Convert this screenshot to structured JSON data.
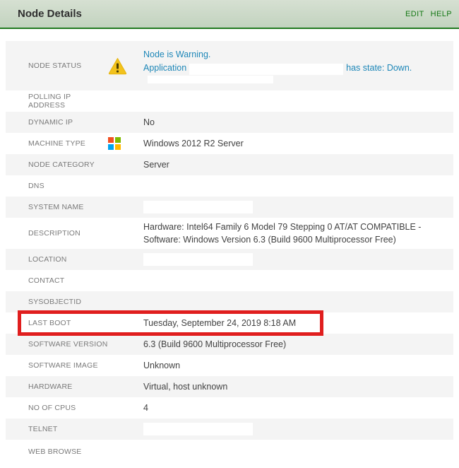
{
  "header": {
    "title": "Node Details",
    "links": [
      {
        "label": "EDIT"
      },
      {
        "label": "HELP"
      }
    ]
  },
  "status_row": {
    "line1": "Node is Warning.",
    "line2_prefix": "Application",
    "line2_suffix": "has state: Down."
  },
  "rows": [
    {
      "label": "NODE STATUS",
      "value": "",
      "bg": "gray",
      "icon": "warning",
      "status": true,
      "height": "h70"
    },
    {
      "label": "POLLING IP ADDRESS",
      "value": "",
      "bg": "white"
    },
    {
      "label": "DYNAMIC IP",
      "value": "No",
      "bg": "gray"
    },
    {
      "label": "MACHINE TYPE",
      "value": "Windows 2012 R2 Server",
      "bg": "white",
      "icon": "windows"
    },
    {
      "label": "NODE CATEGORY",
      "value": "Server",
      "bg": "gray"
    },
    {
      "label": "DNS",
      "value": "",
      "bg": "white"
    },
    {
      "label": "SYSTEM NAME",
      "value": "",
      "bg": "gray",
      "redacted": true
    },
    {
      "label": "DESCRIPTION",
      "value": "Hardware: Intel64 Family 6 Model 79 Stepping 0 AT/AT COMPATIBLE -\nSoftware: Windows Version 6.3 (Build 9600 Multiprocessor Free)",
      "bg": "white",
      "height": "h44"
    },
    {
      "label": "LOCATION",
      "value": "",
      "bg": "gray",
      "redacted": true
    },
    {
      "label": "CONTACT",
      "value": "",
      "bg": "white"
    },
    {
      "label": "SYSOBJECTID",
      "value": "",
      "bg": "gray"
    },
    {
      "label": "LAST BOOT",
      "value": "Tuesday, September 24, 2019 8:18 AM",
      "bg": "white",
      "highlighted": true
    },
    {
      "label": "SOFTWARE VERSION",
      "value": "6.3 (Build 9600 Multiprocessor Free)",
      "bg": "gray"
    },
    {
      "label": "SOFTWARE IMAGE",
      "value": "Unknown",
      "bg": "white"
    },
    {
      "label": "HARDWARE",
      "value": "Virtual, host unknown",
      "bg": "gray"
    },
    {
      "label": "NO OF CPUS",
      "value": "4",
      "bg": "white"
    },
    {
      "label": "TELNET",
      "value": "",
      "bg": "gray",
      "redacted": true
    },
    {
      "label": "WEB BROWSE",
      "value": "",
      "bg": "white",
      "height": "h33"
    }
  ],
  "colors": {
    "header_bg_top": "#d6e0d2",
    "header_bg_bottom": "#c2d3bf",
    "header_border_green": "#217a21",
    "link_green": "#157815",
    "row_gray": "#f4f4f4",
    "status_blue": "#1e87b8",
    "warning_yellow": "#f2c21c",
    "highlight_red": "#e01e1e",
    "windows_red": "#f25022",
    "windows_green": "#7fba00",
    "windows_blue": "#00a4ef",
    "windows_yellow": "#ffb900",
    "label_gray": "#7a7a7a",
    "value_dark": "#424242"
  }
}
